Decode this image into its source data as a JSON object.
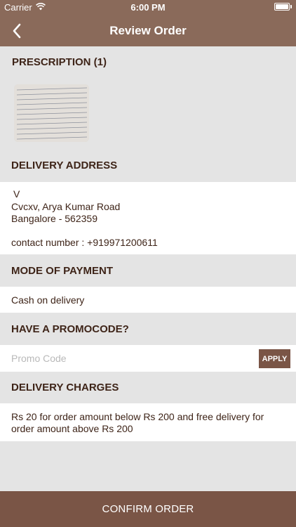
{
  "status_bar": {
    "carrier": "Carrier",
    "time": "6:00 PM"
  },
  "nav": {
    "title": "Review Order"
  },
  "prescription": {
    "heading": "PRESCRIPTION (1)"
  },
  "delivery_address": {
    "heading": "DELIVERY ADDRESS",
    "name": "V",
    "line1": "Cvcxv, Arya Kumar Road",
    "line2": "Bangalore - 562359",
    "contact": "contact number : +919971200611"
  },
  "payment": {
    "heading": "MODE OF PAYMENT",
    "method": "Cash on delivery"
  },
  "promo": {
    "heading": "HAVE A PROMOCODE?",
    "placeholder": "Promo Code",
    "apply_label": "APPLY"
  },
  "delivery_charges": {
    "heading": "DELIVERY CHARGES",
    "line1": "Rs 20 for order amount below Rs 200 and free delivery for",
    "line2": "order amount above Rs 200"
  },
  "confirm": {
    "label": "CONFIRM ORDER"
  },
  "colors": {
    "brand": "#8a6a5a",
    "button": "#7a5546",
    "heading_text": "#3e2418",
    "background": "#e4e4e4"
  }
}
